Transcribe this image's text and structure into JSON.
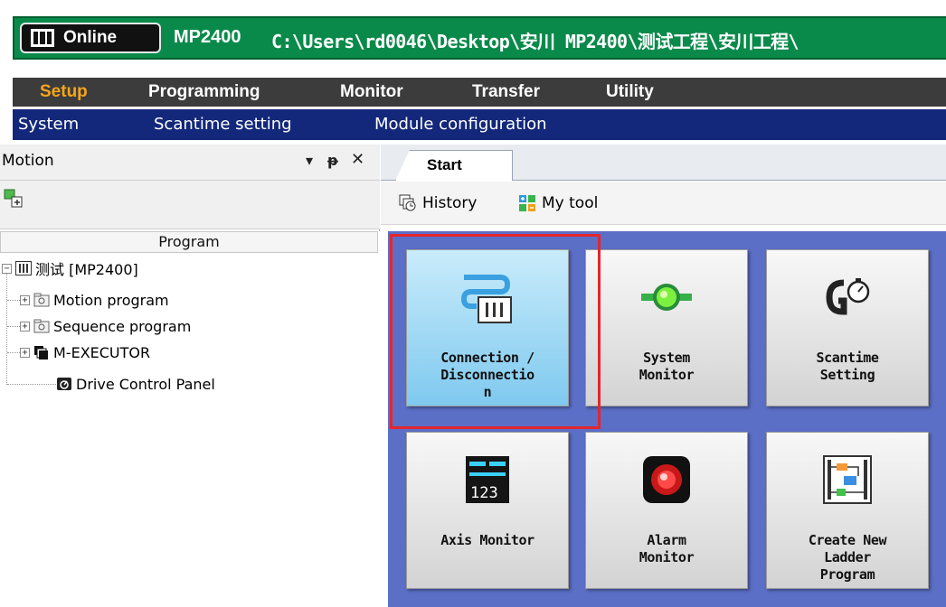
{
  "titlebar": {
    "status": "Online",
    "model": "MP2400",
    "path": "C:\\Users\\rd0046\\Desktop\\安川 MP2400\\测试工程\\安川工程\\"
  },
  "menubar": {
    "items": [
      "Setup",
      "Programming",
      "Monitor",
      "Transfer",
      "Utility"
    ],
    "active": "Setup"
  },
  "submenu": {
    "items": [
      "System",
      "Scantime setting",
      "Module configuration"
    ]
  },
  "left_panel": {
    "title": "Motion",
    "pin_glyph": "▾ ᵽ ✕",
    "tree_header": "Program",
    "root": "测试 [MP2400]",
    "nodes": [
      "Motion program",
      "Sequence program",
      "M-EXECUTOR",
      "Drive Control Panel"
    ]
  },
  "right_panel": {
    "tab": "Start",
    "toolbar": {
      "history": "History",
      "my_tool": "My tool"
    },
    "tiles": [
      {
        "label": "Connection /\nDisconnectio\nn",
        "icon": "connection-icon"
      },
      {
        "label": "System\nMonitor",
        "icon": "system-monitor-icon"
      },
      {
        "label": "Scantime\nSetting",
        "icon": "scantime-icon"
      },
      {
        "label": "Axis Monitor",
        "icon": "axis-monitor-icon"
      },
      {
        "label": "Alarm\nMonitor",
        "icon": "alarm-monitor-icon"
      },
      {
        "label": "Create New\nLadder\nProgram",
        "icon": "ladder-program-icon"
      }
    ]
  },
  "colors": {
    "title_green": "#0a8a4a",
    "menu_dark": "#3c3c3c",
    "menu_active": "#f7a51c",
    "submenu_blue": "#13287a",
    "tiles_bg": "#5b6fc6",
    "selection_red": "#e3262e"
  }
}
